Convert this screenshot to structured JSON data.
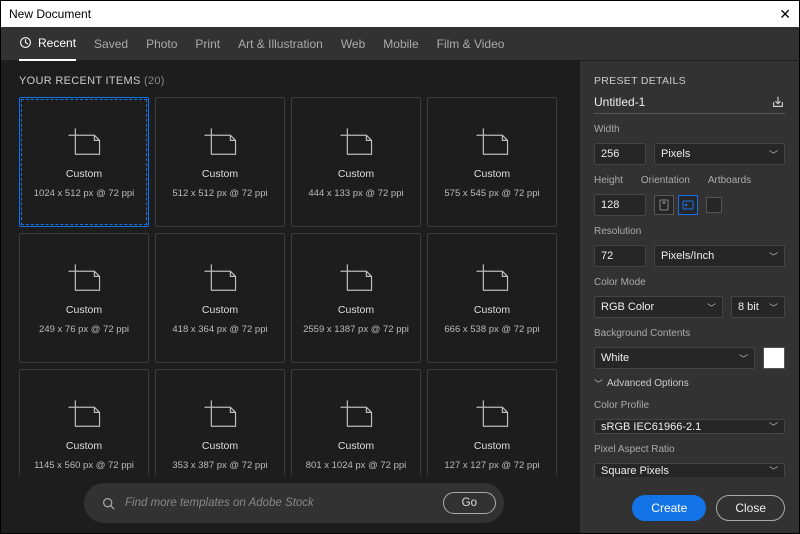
{
  "window": {
    "title": "New Document"
  },
  "tabs": {
    "items": [
      {
        "label": "Recent",
        "name": "tab-recent",
        "active": true
      },
      {
        "label": "Saved",
        "name": "tab-saved"
      },
      {
        "label": "Photo",
        "name": "tab-photo"
      },
      {
        "label": "Print",
        "name": "tab-print"
      },
      {
        "label": "Art & Illustration",
        "name": "tab-art"
      },
      {
        "label": "Web",
        "name": "tab-web"
      },
      {
        "label": "Mobile",
        "name": "tab-mobile"
      },
      {
        "label": "Film & Video",
        "name": "tab-film"
      }
    ]
  },
  "recent": {
    "heading": "YOUR RECENT ITEMS",
    "count_label": "(20)",
    "items": [
      {
        "title": "Custom",
        "detail": "1024 x 512 px @ 72 ppi",
        "selected": true
      },
      {
        "title": "Custom",
        "detail": "512 x 512 px @ 72 ppi"
      },
      {
        "title": "Custom",
        "detail": "444 x 133 px @ 72 ppi"
      },
      {
        "title": "Custom",
        "detail": "575 x 545 px @ 72 ppi"
      },
      {
        "title": "Custom",
        "detail": "249 x 76 px @ 72 ppi"
      },
      {
        "title": "Custom",
        "detail": "418 x 364 px @ 72 ppi"
      },
      {
        "title": "Custom",
        "detail": "2559 x 1387 px @ 72 ppi"
      },
      {
        "title": "Custom",
        "detail": "666 x 538 px @ 72 ppi"
      },
      {
        "title": "Custom",
        "detail": "1145 x 560 px @ 72 ppi"
      },
      {
        "title": "Custom",
        "detail": "353 x 387 px @ 72 ppi"
      },
      {
        "title": "Custom",
        "detail": "801 x 1024 px @ 72 ppi"
      },
      {
        "title": "Custom",
        "detail": "127 x 127 px @ 72 ppi"
      }
    ]
  },
  "search": {
    "placeholder": "Find more templates on Adobe Stock",
    "go_label": "Go"
  },
  "preset": {
    "heading": "PRESET DETAILS",
    "name": "Untitled-1",
    "width_label": "Width",
    "width_value": "256",
    "width_unit": "Pixels",
    "height_label": "Height",
    "height_value": "128",
    "orientation_label": "Orientation",
    "artboards_label": "Artboards",
    "resolution_label": "Resolution",
    "resolution_value": "72",
    "resolution_unit": "Pixels/Inch",
    "colormode_label": "Color Mode",
    "colormode_value": "RGB Color",
    "bitdepth_value": "8 bit",
    "background_label": "Background Contents",
    "background_value": "White",
    "advanced_label": "Advanced Options",
    "profile_label": "Color Profile",
    "profile_value": "sRGB IEC61966-2.1",
    "aspect_label": "Pixel Aspect Ratio",
    "aspect_value": "Square Pixels"
  },
  "footer": {
    "create_label": "Create",
    "close_label": "Close"
  }
}
